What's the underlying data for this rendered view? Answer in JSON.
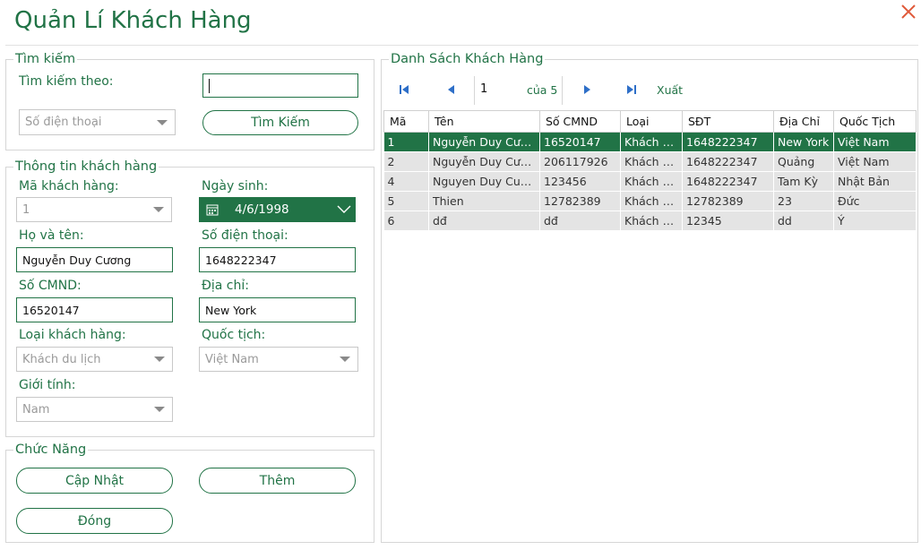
{
  "app": {
    "title": "Quản Lí Khách Hàng"
  },
  "colors": {
    "accent": "#217346",
    "close": "#e05a3a"
  },
  "search": {
    "legend": "Tìm kiếm",
    "by_label": "Tìm kiếm theo:",
    "input_value": "",
    "by_select": "Số điện thoại",
    "button": "Tìm Kiếm"
  },
  "info": {
    "legend": "Thông tin khách hàng",
    "ma_label": "Mã khách hàng:",
    "ma_value": "1",
    "ngaysinh_label": "Ngày sinh:",
    "ngaysinh_value": "4/6/1998",
    "hoten_label": "Họ và tên:",
    "hoten_value": "Nguyễn Duy Cương",
    "sdt_label": "Số điện thoại:",
    "sdt_value": "1648222347",
    "cmnd_label": "Số CMND:",
    "cmnd_value": "16520147",
    "diachi_label": "Địa chỉ:",
    "diachi_value": "New York",
    "loai_label": "Loại khách hàng:",
    "loai_value": "Khách du lịch",
    "quoctich_label": "Quốc tịch:",
    "quoctich_value": "Việt Nam",
    "gioitinh_label": "Giới tính:",
    "gioitinh_value": "Nam"
  },
  "functions": {
    "legend": "Chức Năng",
    "update": "Cập Nhật",
    "add": "Thêm",
    "close": "Đóng"
  },
  "list": {
    "legend": "Danh Sách Khách Hàng",
    "page_current": "1",
    "page_of": "của 5",
    "export": "Xuất",
    "columns": [
      "Mã",
      "Tên",
      "Số CMND",
      "Loại",
      "SĐT",
      "Địa Chỉ",
      "Quốc Tịch"
    ],
    "rows": [
      [
        "1",
        "Nguyễn Duy Cương",
        "16520147",
        "Khách d...",
        "1648222347",
        "New York",
        "Việt Nam"
      ],
      [
        "2",
        "Nguyễn Duy Cương",
        "206117926",
        "Khách đị...",
        "1648222347",
        "Quảng",
        "Việt Nam"
      ],
      [
        "4",
        "Nguyen Duy Cuong",
        "123456",
        "Khách vã...",
        "1648222347",
        "Tam Kỳ",
        "Nhật Bản"
      ],
      [
        "5",
        "Thien",
        "12782389",
        "Khách d...",
        "12782389",
        "23",
        "Đức"
      ],
      [
        "6",
        "dđ",
        "dđ",
        "Khách d...",
        "12345",
        "dd",
        "Ý"
      ]
    ],
    "selected_row": 0
  }
}
